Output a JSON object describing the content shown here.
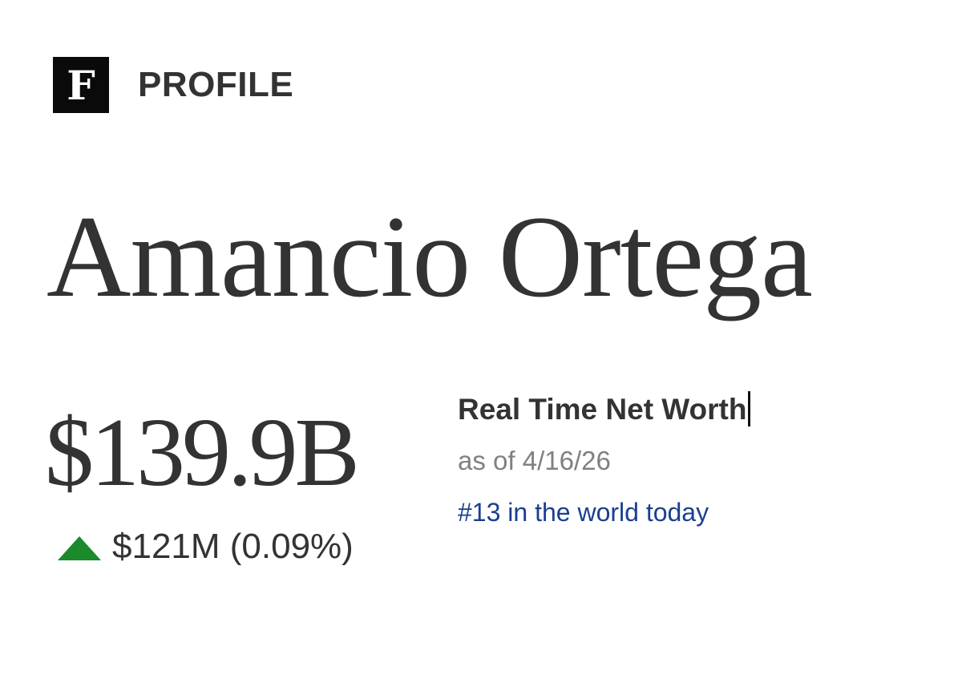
{
  "header": {
    "logo_letter": "F",
    "section_label": "PROFILE"
  },
  "profile": {
    "name": "Amancio Ortega",
    "net_worth": "$139.9B",
    "change": {
      "direction": "up",
      "text": "$121M (0.09%)",
      "color": "#1a8a2a"
    },
    "real_time_label": "Real Time Net Worth",
    "as_of": "as of 4/16/26",
    "rank_text": "#13 in the world today"
  },
  "colors": {
    "text": "#333333",
    "muted": "#808080",
    "link": "#1a3f8f",
    "logo_bg": "#0a0a0a"
  }
}
